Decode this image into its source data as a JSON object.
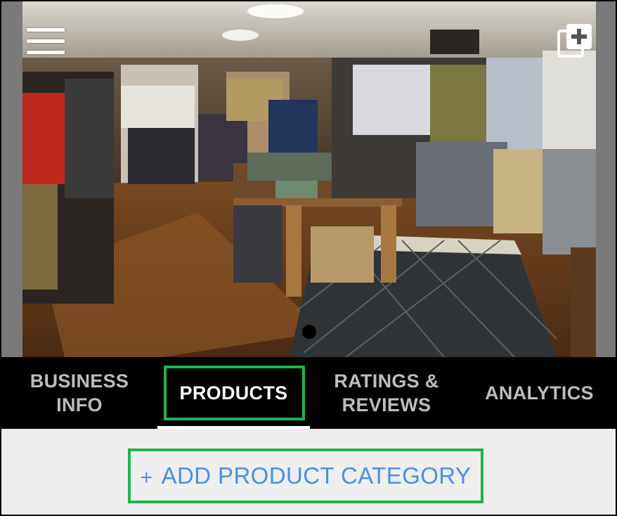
{
  "header": {
    "menu_icon": "hamburger-menu-icon",
    "add_photo_icon": "add-photo-icon",
    "hero_image": "clothing-store-interior-photo",
    "page_indicator_active": 1
  },
  "tabs": [
    {
      "label": "BUSINESS\nINFO",
      "active": false
    },
    {
      "label": "PRODUCTS",
      "active": true
    },
    {
      "label": "RATINGS &\nREVIEWS",
      "active": false
    },
    {
      "label": "ANALYTICS",
      "active": false
    }
  ],
  "content": {
    "add_category_plus": "+",
    "add_category_label": "ADD PRODUCT CATEGORY"
  },
  "colors": {
    "tab_bar_bg": "#000000",
    "tab_active_text": "#ffffff",
    "tab_inactive_text": "#bdbdbd",
    "highlight_box": "#1db34d",
    "button_text": "#4a8fe2",
    "content_bg": "#eeeeee"
  }
}
